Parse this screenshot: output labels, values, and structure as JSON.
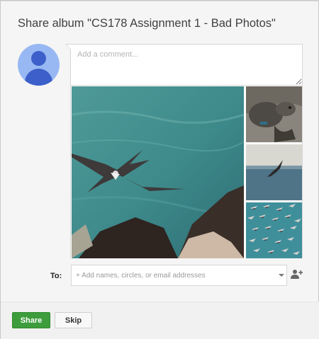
{
  "dialog": {
    "title": "Share album \"CS178 Assignment 1 - Bad Photos\"",
    "comment_placeholder": "Add a comment...",
    "to_label": "To:",
    "to_placeholder": "+ Add names, circles, or email addresses",
    "share_label": "Share",
    "skip_label": "Skip"
  },
  "photos": [
    {
      "name": "seabird-over-ocean",
      "icon": "image"
    },
    {
      "name": "tortoise",
      "icon": "image"
    },
    {
      "name": "bird-over-sea",
      "icon": "image"
    },
    {
      "name": "bird-flock",
      "icon": "image"
    }
  ],
  "colors": {
    "share_button": "#3d9c3c",
    "avatar_bg": "#97b8f2",
    "avatar_fg": "#3c5fc9"
  }
}
